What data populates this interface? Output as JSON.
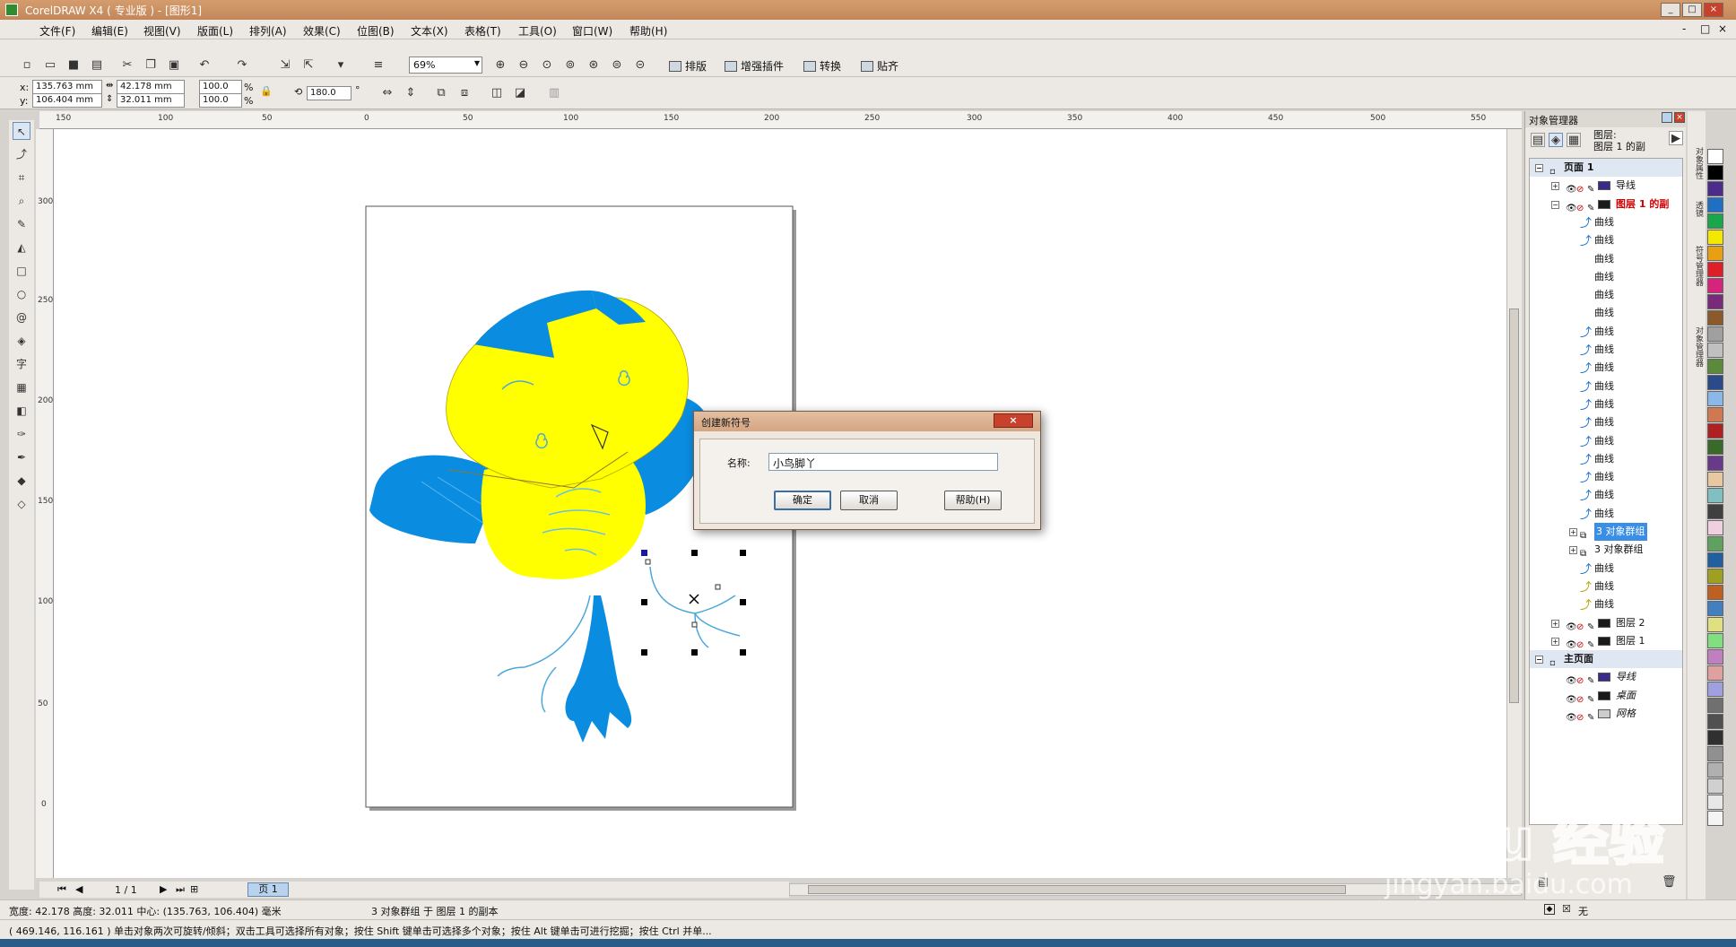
{
  "window": {
    "title": "CorelDRAW X4 ( 专业版 ) - [图形1]",
    "controls": [
      "_",
      "□",
      "×"
    ],
    "mdi_controls": [
      "-",
      "□",
      "×"
    ]
  },
  "menu": [
    "文件(F)",
    "编辑(E)",
    "视图(V)",
    "版面(L)",
    "排列(A)",
    "效果(C)",
    "位图(B)",
    "文本(X)",
    "表格(T)",
    "工具(O)",
    "窗口(W)",
    "帮助(H)"
  ],
  "toolbar": {
    "zoom": "69%",
    "plugins": [
      "排版",
      "增强插件",
      "转换",
      "贴齐"
    ]
  },
  "propbar": {
    "x_label": "x:",
    "x": "135.763 mm",
    "y_label": "y:",
    "y": "106.404 mm",
    "w": "42.178 mm",
    "h": "32.011 mm",
    "scale_x": "100.0",
    "scale_y": "100.0",
    "pct": "%",
    "rotation": "180.0",
    "deg": "°"
  },
  "ruler": {
    "h_ticks": [
      "150",
      "100",
      "50",
      "0",
      "50",
      "100",
      "150",
      "200",
      "250",
      "300",
      "350",
      "400",
      "450",
      "500",
      "550"
    ],
    "v_ticks": [
      "300",
      "250",
      "200",
      "150",
      "100",
      "50",
      "0"
    ]
  },
  "pagebar": {
    "page_count": "1 / 1",
    "page_tab": "页 1"
  },
  "dialog": {
    "title": "创建新符号",
    "close": "×",
    "name_label": "名称:",
    "name_value": "小鸟脚丫",
    "ok": "确定",
    "cancel": "取消",
    "help": "帮助(H)"
  },
  "object_manager": {
    "title": "对象管理器",
    "layer_info_1": "图层:",
    "layer_info_2": "图层 1  的副",
    "rows": [
      {
        "label": "页面 1",
        "kind": "section"
      },
      {
        "label": "导线",
        "kind": "layer",
        "color": "#3a2a8a"
      },
      {
        "label": "图层 1  的副",
        "kind": "layer-active",
        "color": "#1a1a1a"
      },
      {
        "label": "曲线",
        "kind": "curve",
        "icon": "blue"
      },
      {
        "label": "曲线",
        "kind": "curve",
        "icon": "blue"
      },
      {
        "label": "曲线",
        "kind": "curve",
        "icon": "none"
      },
      {
        "label": "曲线",
        "kind": "curve",
        "icon": "none"
      },
      {
        "label": "曲线",
        "kind": "curve",
        "icon": "none"
      },
      {
        "label": "曲线",
        "kind": "curve",
        "icon": "none"
      },
      {
        "label": "曲线",
        "kind": "curve",
        "icon": "blue"
      },
      {
        "label": "曲线",
        "kind": "curve",
        "icon": "blue"
      },
      {
        "label": "曲线",
        "kind": "curve",
        "icon": "blue"
      },
      {
        "label": "曲线",
        "kind": "curve",
        "icon": "blue"
      },
      {
        "label": "曲线",
        "kind": "curve",
        "icon": "blue"
      },
      {
        "label": "曲线",
        "kind": "curve",
        "icon": "blue"
      },
      {
        "label": "曲线",
        "kind": "curve",
        "icon": "blue"
      },
      {
        "label": "曲线",
        "kind": "curve",
        "icon": "blue"
      },
      {
        "label": "曲线",
        "kind": "curve",
        "icon": "blue"
      },
      {
        "label": "曲线",
        "kind": "curve",
        "icon": "blue"
      },
      {
        "label": "曲线",
        "kind": "curve",
        "icon": "blue"
      },
      {
        "label": "3 对象群组",
        "kind": "group-selected"
      },
      {
        "label": "3 对象群组",
        "kind": "group"
      },
      {
        "label": "曲线",
        "kind": "curve",
        "icon": "blue"
      },
      {
        "label": "曲线",
        "kind": "curve",
        "icon": "yellow"
      },
      {
        "label": "曲线",
        "kind": "curve",
        "icon": "yellow"
      },
      {
        "label": "图层 2",
        "kind": "layer",
        "color": "#1a1a1a"
      },
      {
        "label": "图层 1",
        "kind": "layer",
        "color": "#1a1a1a"
      },
      {
        "label": "主页面",
        "kind": "section"
      },
      {
        "label": "导线",
        "kind": "master",
        "color": "#3a2a8a"
      },
      {
        "label": "桌面",
        "kind": "master",
        "color": "#1a1a1a"
      },
      {
        "label": "网格",
        "kind": "master",
        "color": "#cccccc"
      }
    ]
  },
  "side_tabs": [
    "对象属性",
    "透镜",
    "符号管理器",
    "对象管理器"
  ],
  "palette": [
    "#ffffff",
    "#000000",
    "#4b2c8c",
    "#1f6fc4",
    "#18a84a",
    "#f4e800",
    "#e8a010",
    "#e01e28",
    "#d8237c",
    "#7a2a7a",
    "#8b5a2b",
    "#a0a0a0",
    "#c0c0c0",
    "#5a8a3a",
    "#2a4a8a",
    "#8ab8e8",
    "#d07850",
    "#b02020",
    "#3a6a2a",
    "#6a3a8a",
    "#e8c8a0",
    "#80c0c0",
    "#404040",
    "#f0d0e0",
    "#60a060",
    "#2060a0",
    "#a0a020",
    "#c06020",
    "#4080c0",
    "#e0e080",
    "#80e080",
    "#c080c0",
    "#e0a0a0",
    "#a0a0e0",
    "#707070",
    "#505050",
    "#303030",
    "#909090",
    "#b0b0b0",
    "#d0d0d0",
    "#e8e8e8",
    "#f4f4f4"
  ],
  "status": {
    "line1_left": "宽度: 42.178  高度: 32.011  中心: (135.763, 106.404)  毫米",
    "line1_center": "3 对象群组 于 图层 1   的副本",
    "line2": "( 469.146, 116.161 )      单击对象两次可旋转/倾斜；双击工具可选择所有对象；按住 Shift 键单击可选择多个对象；按住 Alt 键单击可进行挖掘；按住 Ctrl 并单...",
    "fill_none": "无"
  },
  "watermark": {
    "logo": "Bai du 经验",
    "url": "jingyan.baidu.com"
  },
  "colors": {
    "bird_yellow": "#ffff00",
    "bird_blue": "#0a8ce0",
    "accent": "#3a6ea5"
  }
}
